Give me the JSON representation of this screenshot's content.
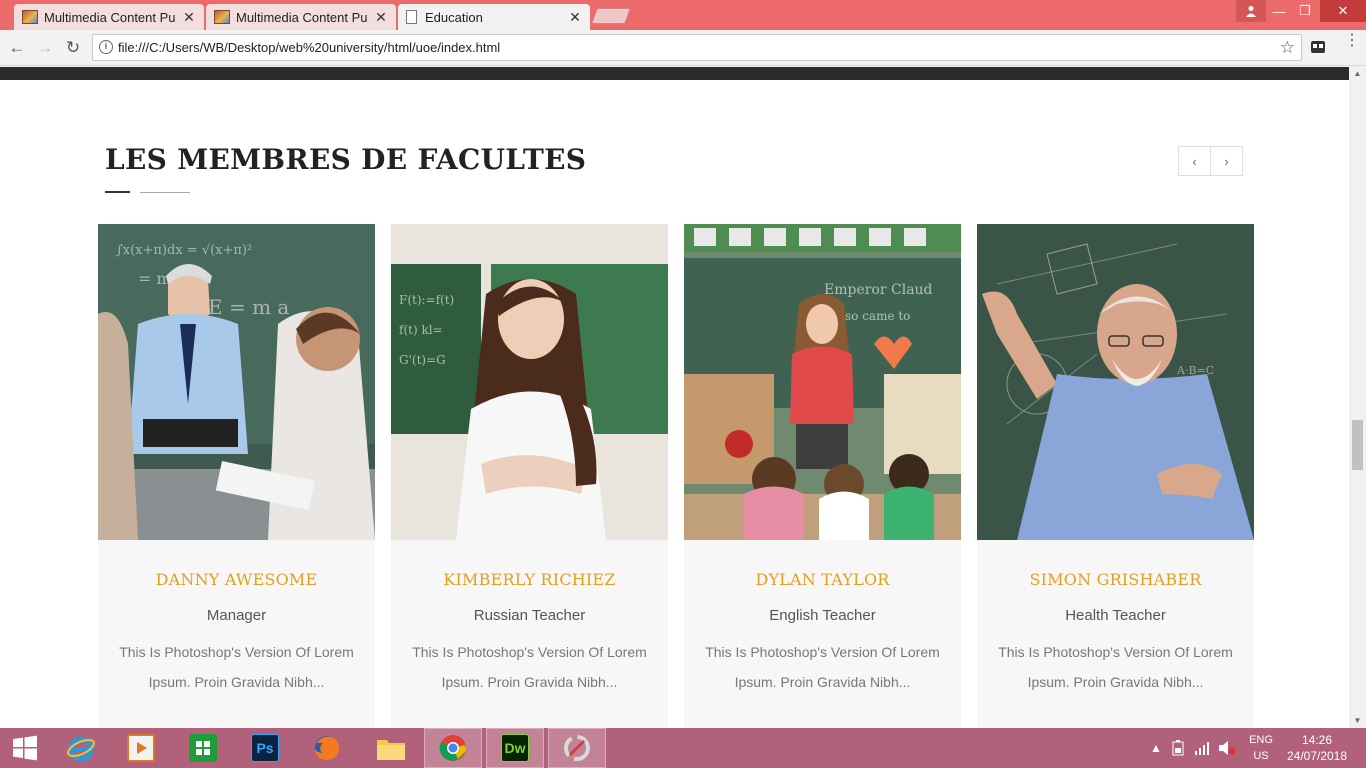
{
  "browser": {
    "tabs": [
      {
        "title": "Multimedia Content Publ",
        "close": "✕"
      },
      {
        "title": "Multimedia Content Publ",
        "close": "✕"
      },
      {
        "title": "Education",
        "close": "✕"
      }
    ],
    "url": "file:///C:/Users/WB/Desktop/web%20university/html/uoe/index.html",
    "window_controls": {
      "minimize": "—",
      "restore": "❐",
      "close": "✕",
      "user": "👤"
    },
    "nav": {
      "back": "←",
      "forward": "→",
      "reload": "↻",
      "info": "i",
      "star": "☆",
      "menu": "⋮"
    }
  },
  "section": {
    "title": "LES MEMBRES DE FACULTES",
    "prev_label": "‹",
    "next_label": "›"
  },
  "faculty": [
    {
      "name": "DANNY AWESOME",
      "role": "Manager",
      "desc": "This Is Photoshop's Version Of Lorem Ipsum. Proin Gravida Nibh..."
    },
    {
      "name": "KIMBERLY RICHIEZ",
      "role": "Russian Teacher",
      "desc": "This Is Photoshop's Version Of Lorem Ipsum. Proin Gravida Nibh..."
    },
    {
      "name": "DYLAN TAYLOR",
      "role": "English Teacher",
      "desc": "This Is Photoshop's Version Of Lorem Ipsum. Proin Gravida Nibh..."
    },
    {
      "name": "SIMON GRISHABER",
      "role": "Health Teacher",
      "desc": "This Is Photoshop's Version Of Lorem Ipsum. Proin Gravida Nibh..."
    }
  ],
  "taskbar": {
    "apps": [
      "start",
      "internet-explorer",
      "media-player",
      "store",
      "photoshop",
      "firefox",
      "file-explorer",
      "chrome",
      "dreamweaver",
      "app"
    ],
    "ps_label": "Ps",
    "dw_label": "Dw",
    "lang_line1": "ENG",
    "lang_line2": "US",
    "time": "14:26",
    "date": "24/07/2018"
  },
  "colors": {
    "accent_name": "#e0a020",
    "tabbar": "#ec6a6a",
    "taskbar": "#b2617a"
  }
}
